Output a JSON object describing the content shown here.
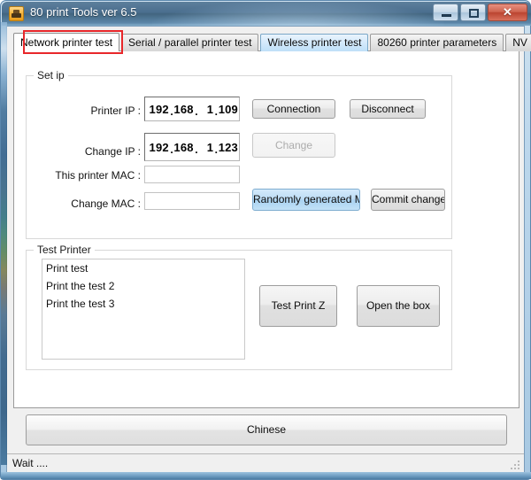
{
  "window": {
    "title": "80 print Tools ver 6.5",
    "icon": "printer-icon",
    "minimize_label": "Minimize",
    "maximize_label": "Maximize",
    "close_label": "✕"
  },
  "tabs": [
    {
      "label": "Network printer test",
      "state": "active"
    },
    {
      "label": "Serial / parallel printer test",
      "state": "normal"
    },
    {
      "label": "Wireless printer test",
      "state": "hover"
    },
    {
      "label": "80260 printer parameters",
      "state": "normal"
    },
    {
      "label": "NV LOGO",
      "state": "normal"
    }
  ],
  "set_ip": {
    "group_title": "Set ip",
    "printer_ip": {
      "label": "Printer IP :",
      "octets": [
        "192",
        "168",
        "1",
        "109"
      ]
    },
    "change_ip": {
      "label": "Change IP :",
      "octets": [
        "192",
        "168",
        "1",
        "123"
      ]
    },
    "this_printer_mac": {
      "label": "This printer MAC :",
      "value": "",
      "placeholder": ""
    },
    "change_mac": {
      "label": "Change MAC :",
      "value": "",
      "placeholder": ""
    },
    "buttons": {
      "connection": "Connection",
      "disconnect": "Disconnect",
      "change": "Change",
      "random_mac": "Randomly generated MAC",
      "commit": "Commit changes"
    },
    "button_states": {
      "change": "disabled",
      "random_mac": "highlighted"
    }
  },
  "test_printer": {
    "group_title": "Test Printer",
    "list_items": [
      "Print test",
      "Print the test 2",
      "Print the test 3"
    ],
    "buttons": {
      "test_print_z": "Test Print Z",
      "open_the_box": "Open the box"
    }
  },
  "footer": {
    "language_button": "Chinese"
  },
  "statusbar": {
    "message": "Wait ...."
  },
  "colors": {
    "title_bar": "#4a6e8e",
    "accent_highlight": "#bcdcf5",
    "annotation_red": "#e8272a",
    "panel_bg": "#f0f0f0",
    "content_bg": "#ffffff"
  }
}
